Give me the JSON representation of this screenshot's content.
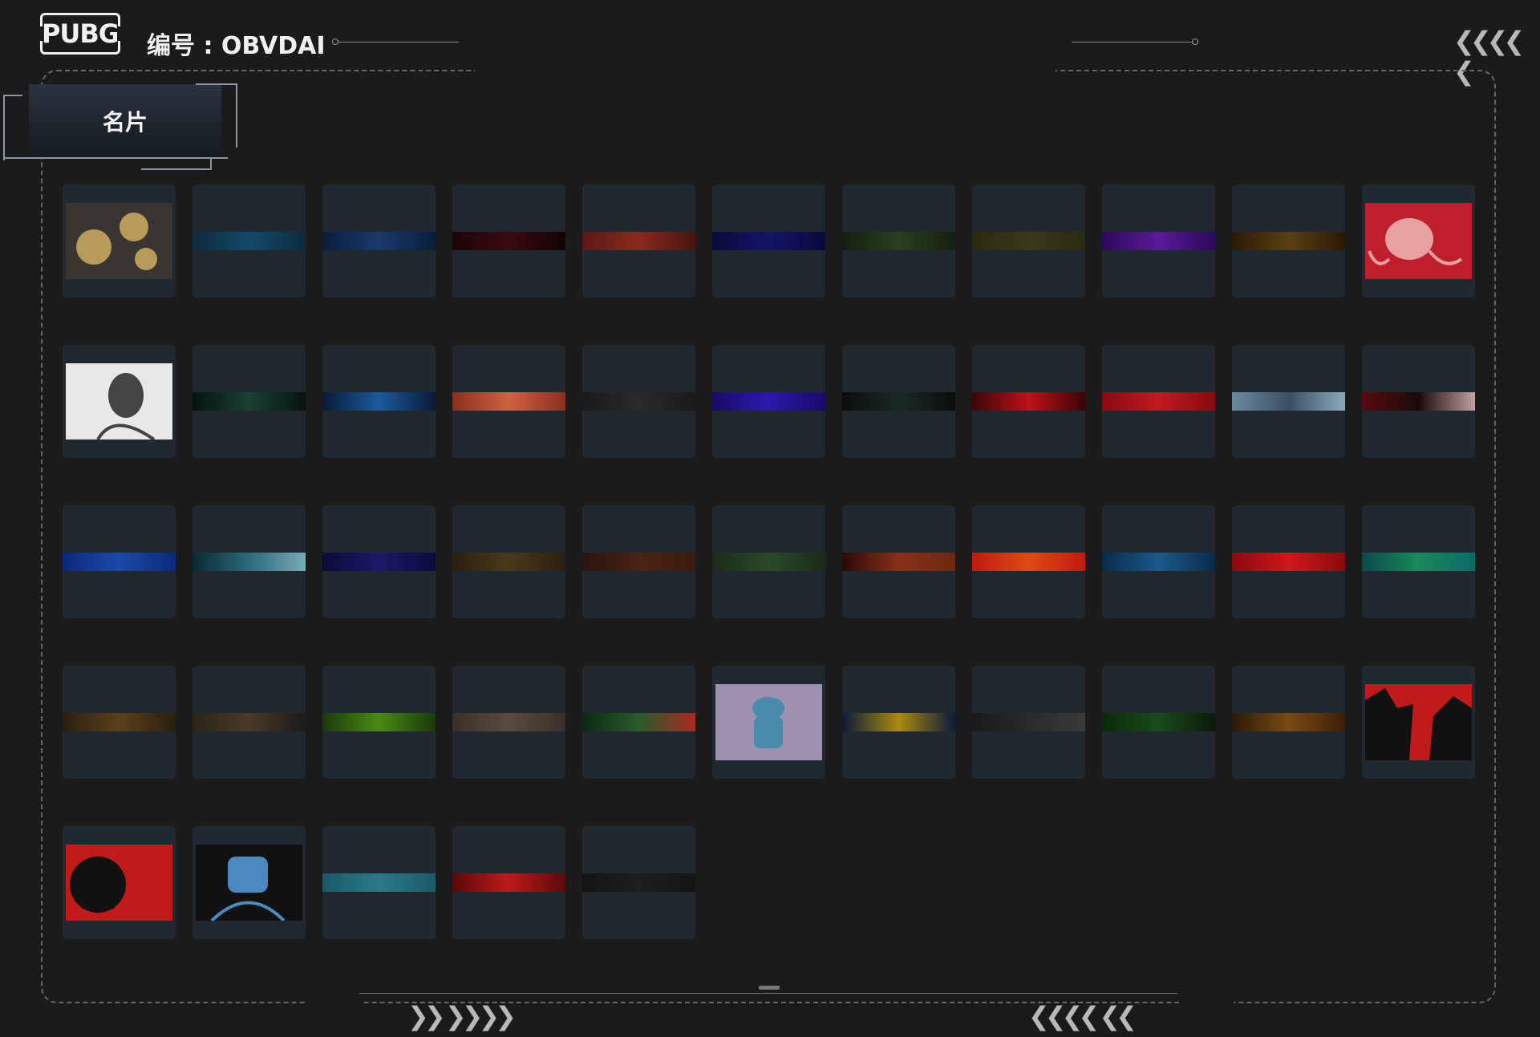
{
  "header": {
    "logo_text": "PUBG",
    "id_label": "编号 : OBVDAI"
  },
  "section": {
    "tab_label": "名片"
  },
  "colors": {
    "background": "#1b1b1c",
    "card_bg": "#202832"
  },
  "icons": {
    "top_right": "chevrons-left-icon",
    "bottom_left": "chevrons-right-icon",
    "bottom_right": "chevrons-left-icon"
  },
  "cards": [
    {
      "kind": "art",
      "subject": "gears-icon",
      "bg": "#3a3530",
      "fg": "#b89a5a"
    },
    {
      "kind": "strip",
      "colors": [
        "#0e2a3d",
        "#124a6a",
        "#0e2a3d"
      ]
    },
    {
      "kind": "strip",
      "colors": [
        "#0a1e3a",
        "#1a3a6a",
        "#0a1e3a"
      ]
    },
    {
      "kind": "strip",
      "colors": [
        "#1a0508",
        "#3a0a10",
        "#120406"
      ]
    },
    {
      "kind": "strip",
      "colors": [
        "#5a1a14",
        "#8a2a1e",
        "#4a1410"
      ]
    },
    {
      "kind": "strip",
      "colors": [
        "#0a0a3a",
        "#14146a",
        "#0a0a3a"
      ]
    },
    {
      "kind": "strip",
      "colors": [
        "#12200e",
        "#2a4020",
        "#12200e"
      ]
    },
    {
      "kind": "strip",
      "colors": [
        "#2a2a10",
        "#3a3a18",
        "#2a2a10"
      ]
    },
    {
      "kind": "strip",
      "colors": [
        "#2a0a5a",
        "#5a1a9a",
        "#2a0a5a"
      ]
    },
    {
      "kind": "strip",
      "colors": [
        "#2a1a06",
        "#5a4010",
        "#2a1a06"
      ]
    },
    {
      "kind": "art",
      "subject": "octopus-icon",
      "bg": "#c01e2c",
      "fg": "#e8a0a0"
    },
    {
      "kind": "art",
      "subject": "sketch-portrait-icon",
      "bg": "#e8e8e8",
      "fg": "#444444"
    },
    {
      "kind": "strip",
      "colors": [
        "#06140e",
        "#1a4030",
        "#06140e"
      ]
    },
    {
      "kind": "strip",
      "colors": [
        "#0a1a3a",
        "#1a5a9a",
        "#0a1a3a"
      ]
    },
    {
      "kind": "strip",
      "colors": [
        "#8a3020",
        "#d06040",
        "#8a3020"
      ]
    },
    {
      "kind": "strip",
      "colors": [
        "#1a1a1a",
        "#2a2a2a",
        "#1a1a1a"
      ]
    },
    {
      "kind": "strip",
      "colors": [
        "#1a0a6a",
        "#2a1aaa",
        "#1a0a6a"
      ]
    },
    {
      "kind": "strip",
      "colors": [
        "#0a0e0e",
        "#1a2a22",
        "#0a0e0e"
      ]
    },
    {
      "kind": "strip",
      "colors": [
        "#3a0608",
        "#c01018",
        "#3a0608"
      ]
    },
    {
      "kind": "strip",
      "colors": [
        "#8a0a10",
        "#c01a20",
        "#8a0a10"
      ]
    },
    {
      "kind": "strip",
      "colors": [
        "#6a8aa0",
        "#3a5060",
        "#8aaabb"
      ]
    },
    {
      "kind": "strip",
      "colors": [
        "#5a0a10",
        "#1a0a0a",
        "#c0a0a0"
      ]
    },
    {
      "kind": "strip",
      "colors": [
        "#0a2a7a",
        "#1a4aaa",
        "#0a2a7a"
      ]
    },
    {
      "kind": "strip",
      "colors": [
        "#0a2a30",
        "#2a6a7a",
        "#7aaab8"
      ]
    },
    {
      "kind": "strip",
      "colors": [
        "#0a0a3a",
        "#1a1a6a",
        "#0a0a3a"
      ]
    },
    {
      "kind": "strip",
      "colors": [
        "#2a2010",
        "#4a3a18",
        "#2a2010"
      ]
    },
    {
      "kind": "strip",
      "colors": [
        "#2a1410",
        "#4a2414",
        "#3a1c10"
      ]
    },
    {
      "kind": "strip",
      "colors": [
        "#1a2a1a",
        "#2a4a2a",
        "#1a2a1a"
      ]
    },
    {
      "kind": "strip",
      "colors": [
        "#2a0a06",
        "#8a3018",
        "#6a2810"
      ]
    },
    {
      "kind": "strip",
      "colors": [
        "#c01a10",
        "#e04a14",
        "#c01a10"
      ]
    },
    {
      "kind": "strip",
      "colors": [
        "#0a2a4a",
        "#1a5a8a",
        "#0a2a4a"
      ]
    },
    {
      "kind": "strip",
      "colors": [
        "#8a0a10",
        "#d01818",
        "#8a0a10"
      ]
    },
    {
      "kind": "strip",
      "colors": [
        "#0a4a4a",
        "#1a8a5a",
        "#0a6a6a"
      ]
    },
    {
      "kind": "strip",
      "colors": [
        "#2a2010",
        "#5a4018",
        "#2a2010"
      ]
    },
    {
      "kind": "strip",
      "colors": [
        "#2a2418",
        "#4a3a28",
        "#1a1a1a"
      ]
    },
    {
      "kind": "strip",
      "colors": [
        "#1a3a0a",
        "#4a8a14",
        "#1a3a0a"
      ]
    },
    {
      "kind": "strip",
      "colors": [
        "#3a3028",
        "#5a4a40",
        "#3a3028"
      ]
    },
    {
      "kind": "strip",
      "colors": [
        "#0a2a14",
        "#2a5a2a",
        "#aa2a20"
      ]
    },
    {
      "kind": "art",
      "subject": "frog-knight-icon",
      "bg": "#a090b0",
      "fg": "#4a8aaa"
    },
    {
      "kind": "strip",
      "colors": [
        "#0a1a3a",
        "#aa8a10",
        "#0a1a3a"
      ]
    },
    {
      "kind": "strip",
      "colors": [
        "#1a1a1a",
        "#2a2a2a",
        "#3a3a3a"
      ]
    },
    {
      "kind": "strip",
      "colors": [
        "#0a2a0a",
        "#1a4a1a",
        "#0a1a0a"
      ]
    },
    {
      "kind": "strip",
      "colors": [
        "#2a1a06",
        "#7a4a14",
        "#3a2008"
      ]
    },
    {
      "kind": "art",
      "subject": "wolves-icon",
      "bg": "#c01a1a",
      "fg": "#111111"
    },
    {
      "kind": "art",
      "subject": "panther-good-luck-icon",
      "bg": "#c01a1a",
      "fg": "#111111"
    },
    {
      "kind": "art",
      "subject": "robot-soldier-icon",
      "bg": "#111111",
      "fg": "#4a8ac0"
    },
    {
      "kind": "strip",
      "colors": [
        "#1a5a6a",
        "#2a7a8a",
        "#1a5a6a"
      ]
    },
    {
      "kind": "strip",
      "colors": [
        "#5a0a0a",
        "#c01a1a",
        "#5a0a0a"
      ]
    },
    {
      "kind": "strip",
      "colors": [
        "#141414",
        "#1e1e1e",
        "#141414"
      ]
    }
  ]
}
